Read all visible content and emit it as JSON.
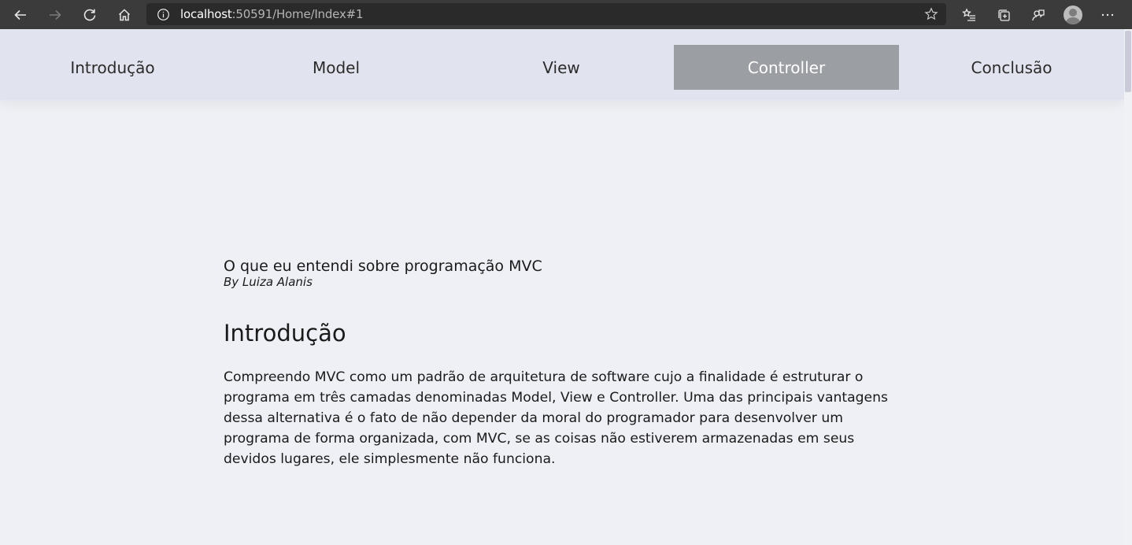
{
  "browser": {
    "url_host": "localhost",
    "url_rest": ":50591/Home/Index#1",
    "icons": [
      "back-icon",
      "forward-icon",
      "refresh-icon",
      "home-icon",
      "info-icon",
      "star-icon",
      "favorites-icon",
      "collections-icon",
      "feedback-icon",
      "avatar",
      "more-icon"
    ]
  },
  "nav": {
    "items": [
      {
        "label": "Introdução"
      },
      {
        "label": "Model"
      },
      {
        "label": "View"
      },
      {
        "label": "Controller",
        "active": true
      },
      {
        "label": "Conclusão"
      }
    ]
  },
  "article": {
    "title": "O que eu entendi sobre programação MVC",
    "byline": "By Luiza Alanis",
    "section_heading": "Introdução",
    "paragraph": "Compreendo MVC como um padrão de arquitetura de software cujo a finalidade é estruturar o programa em três camadas denominadas Model, View e Controller. Uma das principais vantagens dessa alternativa é o fato de não depender da moral do programador para desenvolver um programa de forma organizada, com MVC, se as coisas não estiverem armazenadas em seus devidos lugares, ele simplesmente não funciona."
  },
  "colors": {
    "chrome_bg": "#3b3b3b",
    "nav_bg": "#e1e4ee",
    "nav_active_bg": "#9b9ea3",
    "page_bg": "#eff0f5"
  }
}
